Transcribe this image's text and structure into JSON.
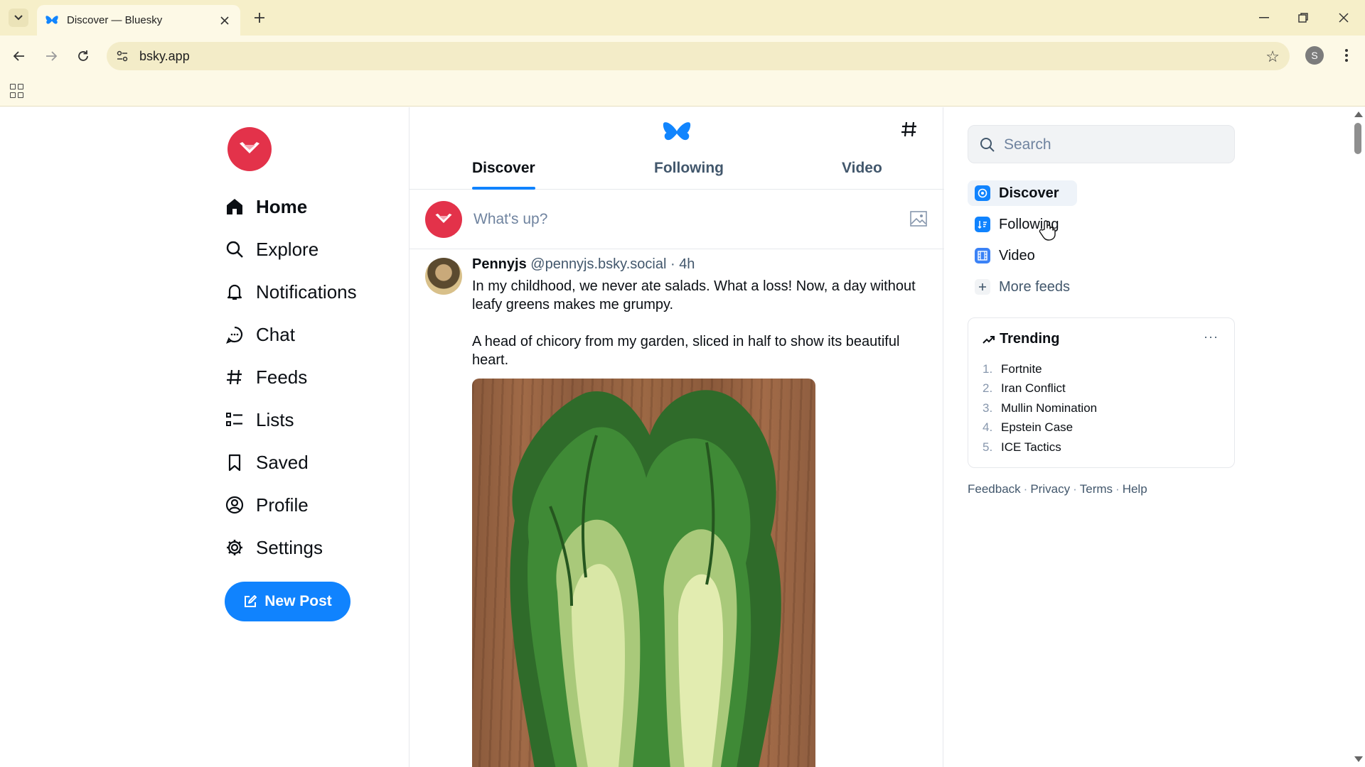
{
  "browser": {
    "tab_title": "Discover — Bluesky",
    "url": "bsky.app",
    "profile_initial": "S"
  },
  "colors": {
    "brand_red": "#e3324a",
    "accent_blue": "#1083fe",
    "chrome_yellow": "#f6efc9"
  },
  "nav": {
    "items": [
      {
        "label": "Home",
        "icon": "home-icon"
      },
      {
        "label": "Explore",
        "icon": "search-icon"
      },
      {
        "label": "Notifications",
        "icon": "bell-icon"
      },
      {
        "label": "Chat",
        "icon": "chat-icon"
      },
      {
        "label": "Feeds",
        "icon": "hash-icon"
      },
      {
        "label": "Lists",
        "icon": "list-icon"
      },
      {
        "label": "Saved",
        "icon": "bookmark-icon"
      },
      {
        "label": "Profile",
        "icon": "profile-icon"
      },
      {
        "label": "Settings",
        "icon": "gear-icon"
      }
    ],
    "new_post_label": "New Post"
  },
  "feed": {
    "tabs": [
      {
        "label": "Discover",
        "active": true
      },
      {
        "label": "Following",
        "active": false
      },
      {
        "label": "Video",
        "active": false
      }
    ],
    "composer_placeholder": "What's up?"
  },
  "post": {
    "author": "Pennyjs",
    "handle": "@pennyjs.bsky.social",
    "time": "4h",
    "paragraphs": [
      "In my childhood, we never ate salads. What a loss! Now, a day without leafy greens makes me grumpy.",
      "A head of chicory from my garden, sliced in half to show its beautiful heart."
    ]
  },
  "sidebar": {
    "search_placeholder": "Search",
    "feeds": [
      {
        "label": "Discover",
        "active": true
      },
      {
        "label": "Following",
        "active": false
      },
      {
        "label": "Video",
        "active": false
      }
    ],
    "more_feeds_label": "More feeds",
    "trending_title": "Trending",
    "trending_more": "···",
    "trending": [
      {
        "num": "1.",
        "label": "Fortnite"
      },
      {
        "num": "2.",
        "label": "Iran Conflict"
      },
      {
        "num": "3.",
        "label": "Mullin Nomination"
      },
      {
        "num": "4.",
        "label": "Epstein Case"
      },
      {
        "num": "5.",
        "label": "ICE Tactics"
      }
    ],
    "footer": [
      "Feedback",
      "Privacy",
      "Terms",
      "Help"
    ]
  }
}
